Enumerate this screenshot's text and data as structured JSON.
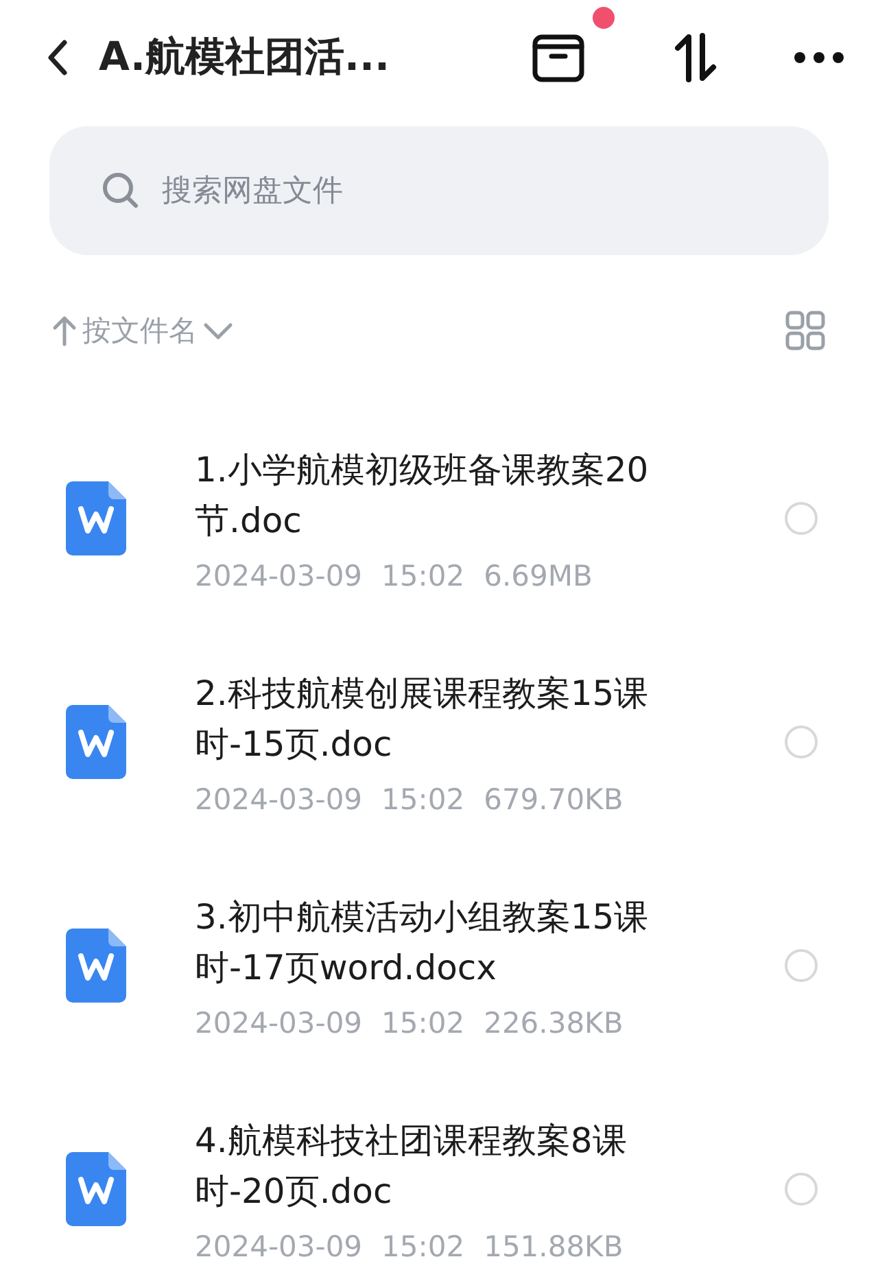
{
  "header": {
    "title": "A.航模社团活...",
    "archive_badge": true
  },
  "search": {
    "placeholder": "搜索网盘文件"
  },
  "sort": {
    "label": "按文件名"
  },
  "files": [
    {
      "name": "1.小学航模初级班备课教案20节.doc",
      "date": "2024-03-09",
      "time": "15:02",
      "size": "6.69MB",
      "selected": false
    },
    {
      "name": "2.科技航模创展课程教案15课时-15页.doc",
      "date": "2024-03-09",
      "time": "15:02",
      "size": "679.70KB",
      "selected": false
    },
    {
      "name": "3.初中航模活动小组教案15课时-17页word.docx",
      "date": "2024-03-09",
      "time": "15:02",
      "size": "226.38KB",
      "selected": false
    },
    {
      "name": "4.航模科技社团课程教案8课时-20页.doc",
      "date": "2024-03-09",
      "time": "15:02",
      "size": "151.88KB",
      "selected": false
    }
  ]
}
